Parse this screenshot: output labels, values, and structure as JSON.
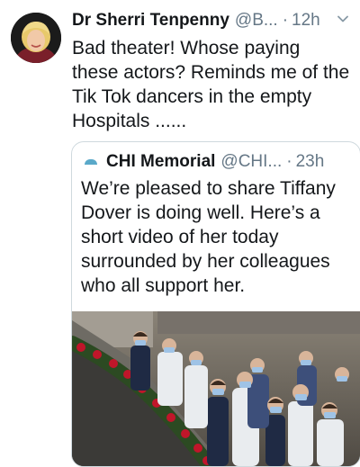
{
  "tweet": {
    "author_name": "Dr Sherri Tenpenny",
    "handle": "@B...",
    "separator": "·",
    "time": "12h",
    "text_lines": [
      "Bad theater!  Whose paying",
      "these actors? Reminds me of the",
      "Tik Tok dancers in the empty",
      "Hospitals ......"
    ],
    "menu_icon": "chevron-down-icon"
  },
  "quoted_tweet": {
    "author_name": "CHI Memorial",
    "handle": "@CHI...",
    "separator": "·",
    "time": "23h",
    "text_lines": [
      "We’re pleased to share Tiffany",
      "Dover is doing well. Here’s a",
      "short video of her today",
      "surrounded by her colleagues",
      "who all support her."
    ],
    "logo_text": "CHI Memorial",
    "media": "video-thumbnail"
  },
  "colors": {
    "text_primary": "#14171a",
    "text_secondary": "#657786",
    "border": "#cfd9de",
    "logo_blue": "#5aa9c9"
  }
}
